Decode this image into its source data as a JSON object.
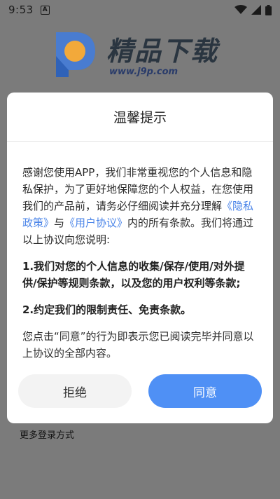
{
  "status_bar": {
    "time": "9:53",
    "notification_letter": "A"
  },
  "background": {
    "logo_title": "精品下载",
    "logo_url": "www.j9p.com",
    "more_login": "更多登录方式"
  },
  "dialog": {
    "title": "温馨提示",
    "intro_part1": "感谢您使用APP，我们非常重视您的个人信息和隐私保护，为了更好地保障您的个人权益，在您使用我们的产品前，请务必仔细阅读并充分理解",
    "privacy_link": "《隐私政策》",
    "intro_and": "与",
    "user_agreement_link": "《用户协议》",
    "intro_part2": "内的所有条款。我们将通过以上协议向您说明:",
    "point1": "1.我们对您的个人信息的收集/保存/使用/对外提供/保护等规则条款，以及您的用户权利等条款;",
    "point2": "2.约定我们的限制责任、免责条款。",
    "consent_text": "您点击“同意”的行为即表示您已阅读完毕并同意以上协议的全部内容。",
    "reject_label": "拒绝",
    "agree_label": "同意"
  },
  "colors": {
    "accent": "#4f90f5",
    "link": "#4a84e8",
    "overlay": "#7b7b7b"
  }
}
